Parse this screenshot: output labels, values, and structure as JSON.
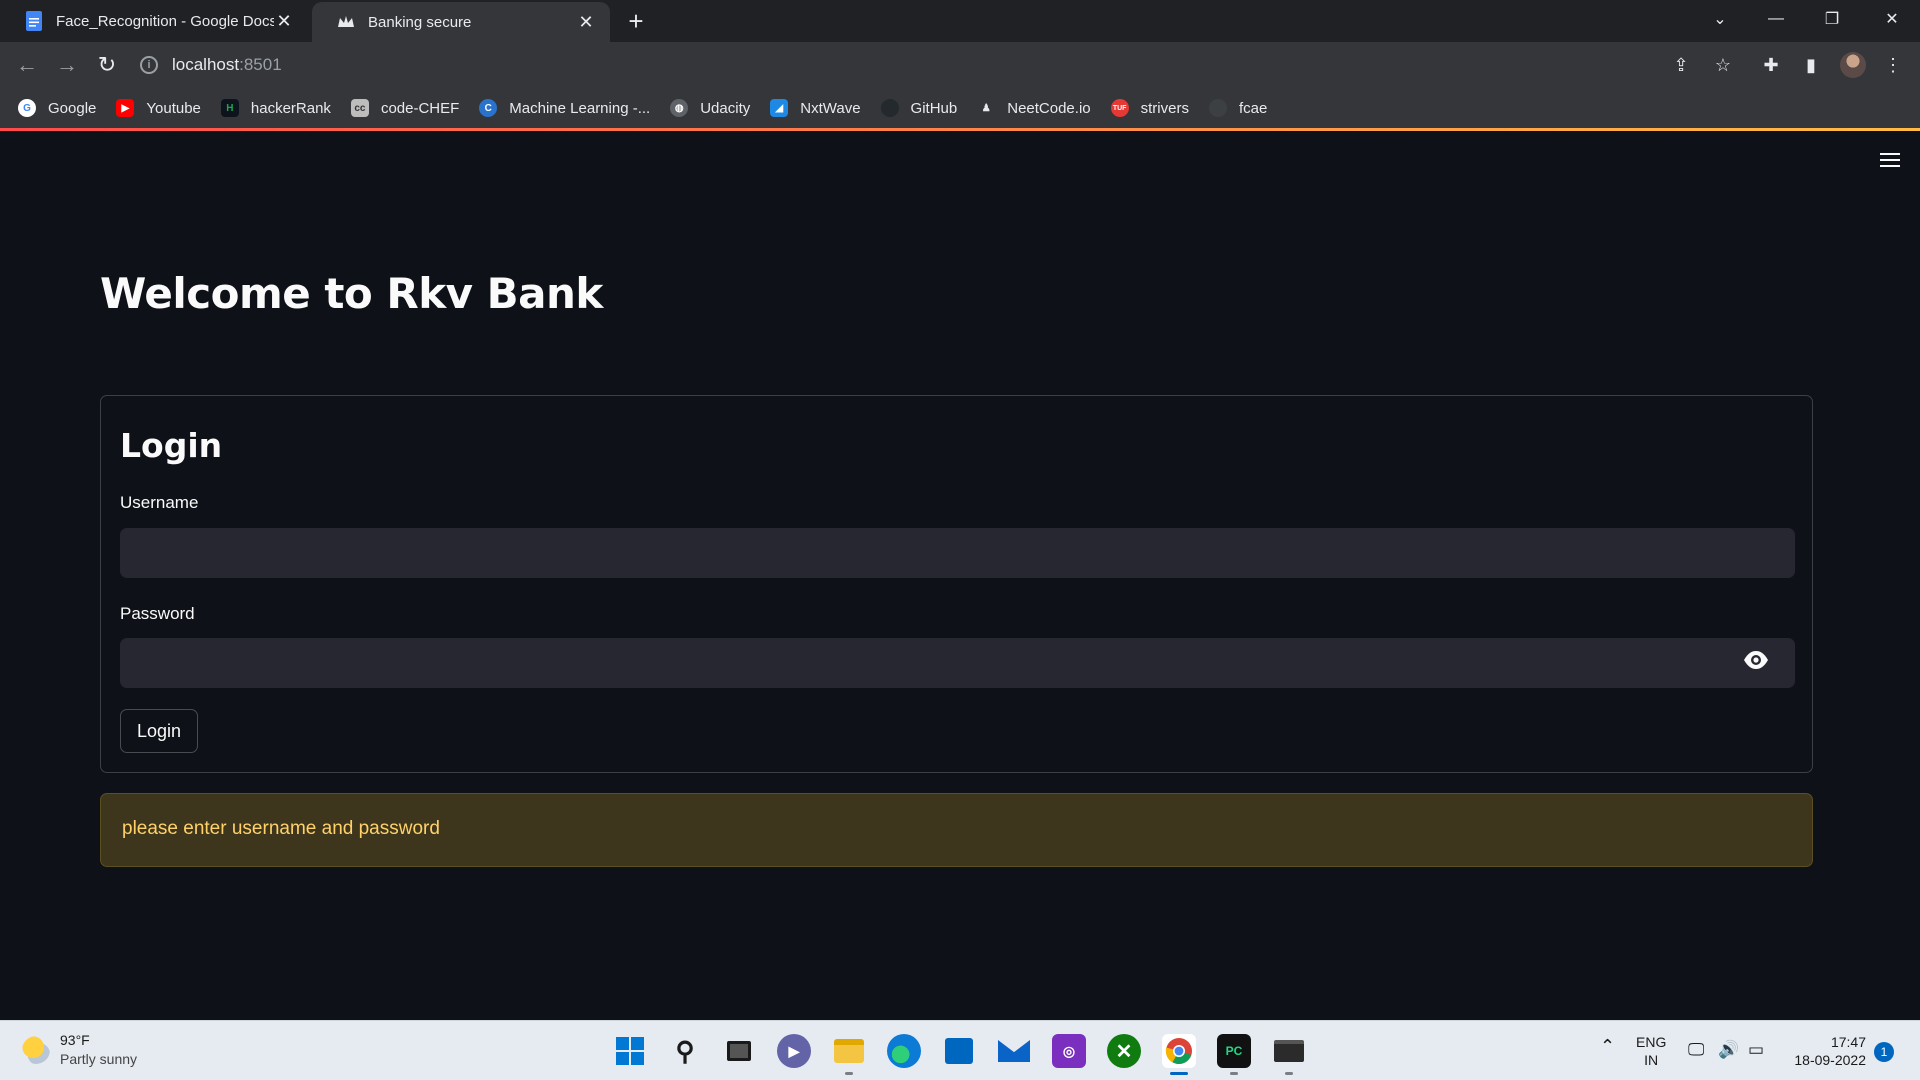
{
  "browser": {
    "tabs": [
      {
        "title": "Face_Recognition - Google Docs",
        "icon": "google-docs-icon",
        "active": false
      },
      {
        "title": "Banking secure",
        "icon": "streamlit-crown-icon",
        "active": true
      }
    ],
    "url_host": "localhost",
    "url_port": ":8501",
    "bookmarks": [
      {
        "label": "Google",
        "icon": "google-icon",
        "color": "#ffffff"
      },
      {
        "label": "Youtube",
        "icon": "youtube-icon",
        "color": "#ff0000"
      },
      {
        "label": "hackerRank",
        "icon": "hackerrank-icon",
        "color": "#1ba94c"
      },
      {
        "label": "code-CHEF",
        "icon": "codechef-icon",
        "color": "#5b4638"
      },
      {
        "label": "Machine Learning -...",
        "icon": "coursera-icon",
        "color": "#2a73cc"
      },
      {
        "label": "Udacity",
        "icon": "globe-icon",
        "color": "#5f6368"
      },
      {
        "label": "NxtWave",
        "icon": "nxtwave-icon",
        "color": "#1e88e5"
      },
      {
        "label": "GitHub",
        "icon": "github-icon",
        "color": "#24292e"
      },
      {
        "label": "NeetCode.io",
        "icon": "neetcode-icon",
        "color": "#e8eaed"
      },
      {
        "label": "strivers",
        "icon": "tuf-icon",
        "color": "#e53935"
      },
      {
        "label": "fcae",
        "icon": "globe-icon",
        "color": "#3c4043"
      }
    ]
  },
  "app": {
    "title": "Welcome to Rkv Bank",
    "form": {
      "title": "Login",
      "username_label": "Username",
      "username_value": "",
      "password_label": "Password",
      "password_value": "",
      "submit_label": "Login"
    },
    "warning": "please enter username and password",
    "accent_warning_color": "#ffd16a"
  },
  "taskbar": {
    "weather_temp": "93°F",
    "weather_desc": "Partly sunny",
    "lang_top": "ENG",
    "lang_bottom": "IN",
    "time": "17:47",
    "date": "18-09-2022",
    "notifications": "1"
  }
}
